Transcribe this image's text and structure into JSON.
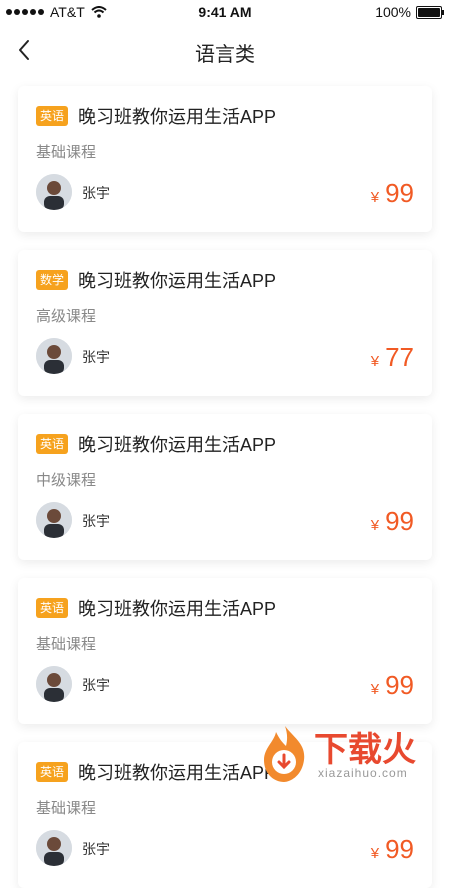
{
  "status_bar": {
    "carrier": "AT&T",
    "time": "9:41 AM",
    "battery": "100%"
  },
  "nav": {
    "title": "语言类",
    "back_icon": "chevron-left-icon"
  },
  "courses": [
    {
      "badge": "英语",
      "title": "晚习班教你运用生活APP",
      "level": "基础课程",
      "teacher": "张宇",
      "currency": "¥",
      "price": "99"
    },
    {
      "badge": "数学",
      "title": "晚习班教你运用生活APP",
      "level": "高级课程",
      "teacher": "张宇",
      "currency": "¥",
      "price": "77"
    },
    {
      "badge": "英语",
      "title": "晚习班教你运用生活APP",
      "level": "中级课程",
      "teacher": "张宇",
      "currency": "¥",
      "price": "99"
    },
    {
      "badge": "英语",
      "title": "晚习班教你运用生活APP",
      "level": "基础课程",
      "teacher": "张宇",
      "currency": "¥",
      "price": "99"
    },
    {
      "badge": "英语",
      "title": "晚习班教你运用生活APP",
      "level": "基础课程",
      "teacher": "张宇",
      "currency": "¥",
      "price": "99"
    }
  ],
  "watermark": {
    "text": "下载火",
    "sub": "xiazaihuo.com"
  },
  "colors": {
    "accent": "#f6a21e",
    "price": "#f15a24"
  }
}
